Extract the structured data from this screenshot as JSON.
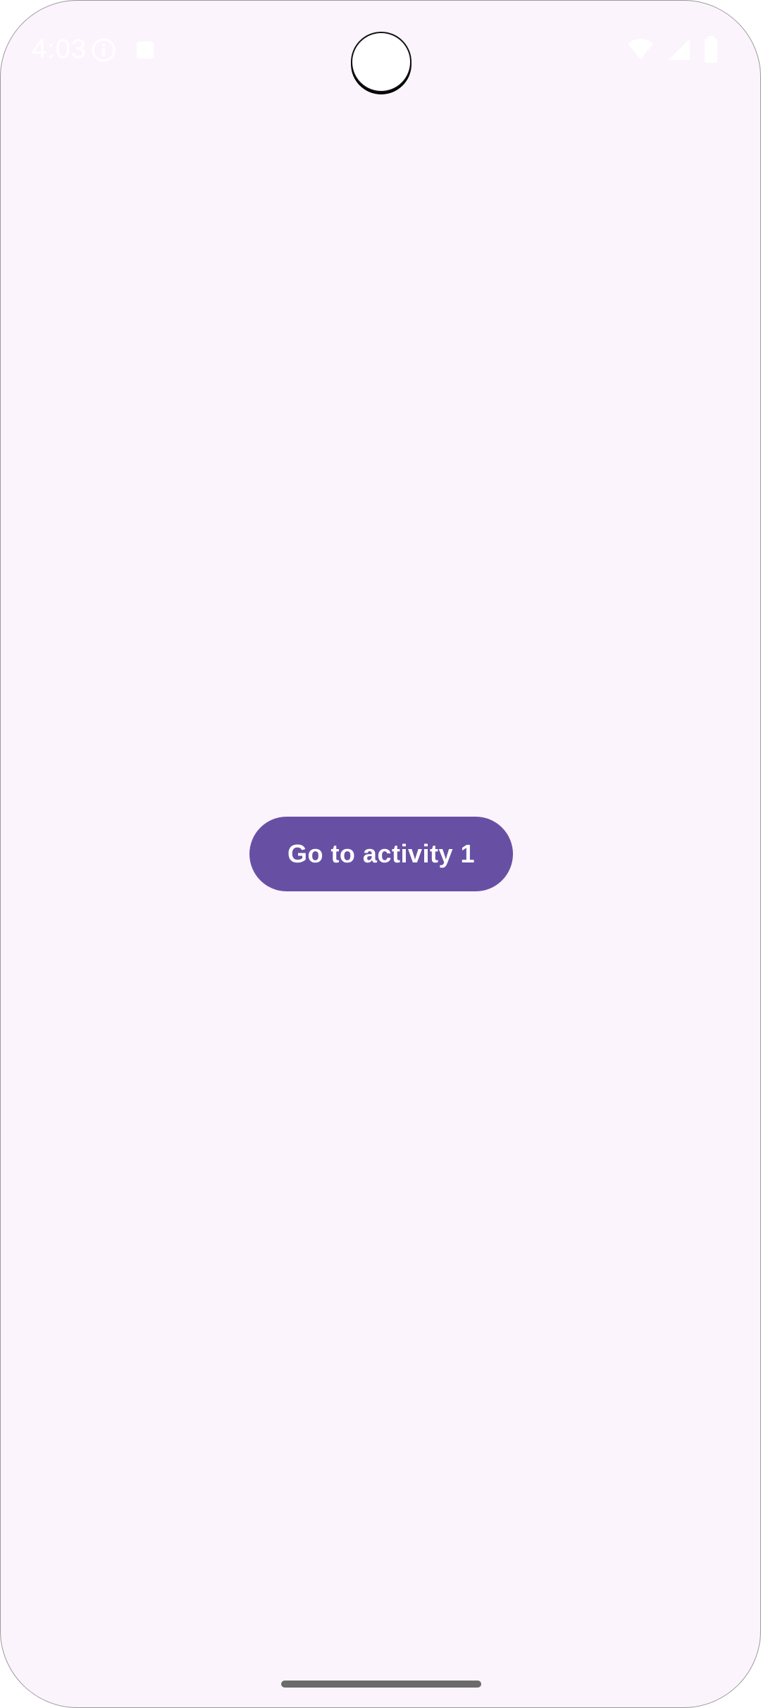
{
  "status_bar": {
    "time": "4:03",
    "left_icons": [
      "info-circle-icon",
      "notification-square-icon"
    ],
    "right_icons": [
      "wifi-icon",
      "cellular-signal-icon",
      "battery-icon"
    ]
  },
  "main": {
    "button_label": "Go to activity 1"
  },
  "colors": {
    "background": "#fcf4fc",
    "primary": "#6750a4",
    "on_primary": "#ffffff",
    "home_indicator": "#6b6b6b"
  }
}
